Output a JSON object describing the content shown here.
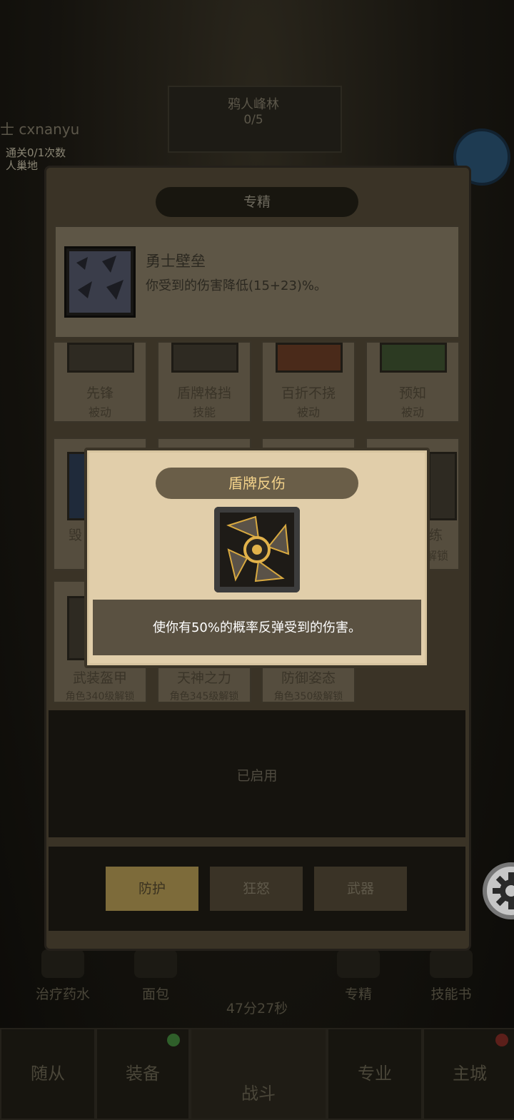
{
  "background": {
    "stage_name": "鸦人峰林",
    "stage_progress": "0/5",
    "username": "士 cxnanyu",
    "info_line1": "通关0/1次数",
    "info_line2": "人巢地",
    "timer": "47分27秒",
    "utility_items": [
      {
        "label": "治疗药水"
      },
      {
        "label": "面包"
      },
      {
        "label": "专精"
      },
      {
        "label": "技能书"
      }
    ],
    "bottom_nav": [
      {
        "label": "随从"
      },
      {
        "label": "装备"
      },
      {
        "label": "战斗"
      },
      {
        "label": "专业"
      },
      {
        "label": "主城"
      }
    ]
  },
  "panel": {
    "title": "专精",
    "selected_skill": {
      "name": "勇士壁垒",
      "description": "你受到的伤害降低(15+23)%。"
    },
    "row1": [
      {
        "name": "先锋",
        "type": "被动"
      },
      {
        "name": "盾牌格挡",
        "type": "技能"
      },
      {
        "name": "百折不挠",
        "type": "被动"
      },
      {
        "name": "预知",
        "type": "被动"
      }
    ],
    "row2": [
      {
        "name": "毁",
        "unlock": ""
      },
      {
        "name": "",
        "unlock": ""
      },
      {
        "name": "",
        "unlock": ""
      },
      {
        "name": "练",
        "unlock": "解锁"
      }
    ],
    "row3": [
      {
        "name": "武装盔甲",
        "unlock": "角色340级解锁"
      },
      {
        "name": "天神之力",
        "unlock": "角色345级解锁"
      },
      {
        "name": "防御姿态",
        "unlock": "角色350级解锁"
      }
    ],
    "enabled_text": "已启用",
    "tabs": [
      {
        "label": "防护"
      },
      {
        "label": "狂怒"
      },
      {
        "label": "武器"
      }
    ]
  },
  "popup": {
    "title": "盾牌反伤",
    "description": "使你有50%的概率反弹受到的伤害。",
    "icon": "shield-reflect-icon"
  },
  "colors": {
    "popup_title_text": "#f3d28a",
    "active_tab_bg": "#7d6b3a",
    "panel_bg": "#3a3326"
  }
}
